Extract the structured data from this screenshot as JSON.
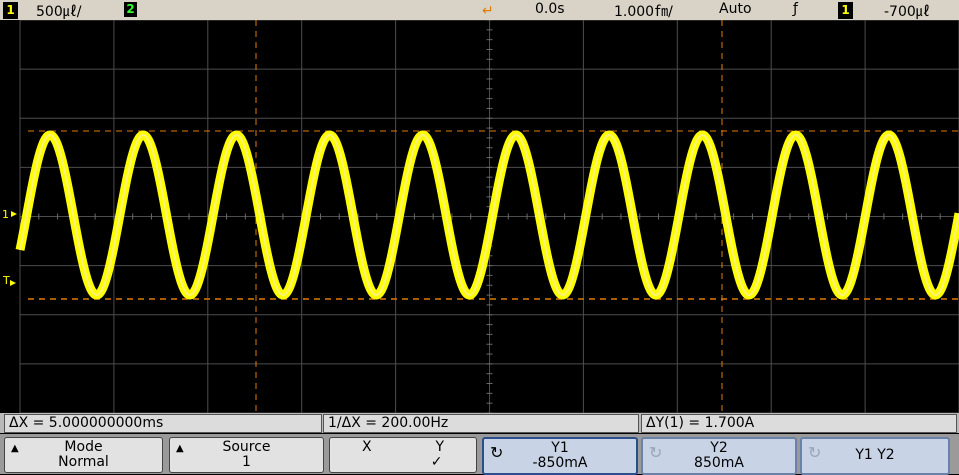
{
  "topbar": {
    "ch1_badge": "1",
    "ch1_scale": "500㎕/",
    "ch2_badge": "2",
    "delay": "0.0s",
    "time_scale": "1.000㎙/",
    "trigger_mode": "Auto",
    "trigger_edge": "ƒ",
    "trig_src_badge": "1",
    "trigger_level": "-700㎕"
  },
  "markers": {
    "ch1_ground": "1",
    "trig_level": "T"
  },
  "readouts": {
    "delta_x": "ΔX = 5.000000000ms",
    "inv_delta_x": "1/ΔX = 200.00Hz",
    "delta_y": "ΔY(1) = 1.700A"
  },
  "softkeys": {
    "mode": {
      "label": "Mode",
      "value": "Normal"
    },
    "source": {
      "label": "Source",
      "value": "1"
    },
    "xy": {
      "x": "X",
      "y": "Y",
      "check": "✓"
    },
    "y1": {
      "label": "Y1",
      "value": "-850mA"
    },
    "y2": {
      "label": "Y2",
      "value": "850mA"
    },
    "y1y2": {
      "label": "Y1 Y2"
    }
  },
  "colors": {
    "trace": "#ffff00",
    "cursor": "#e07b00",
    "grid": "#5a5a5a"
  }
}
